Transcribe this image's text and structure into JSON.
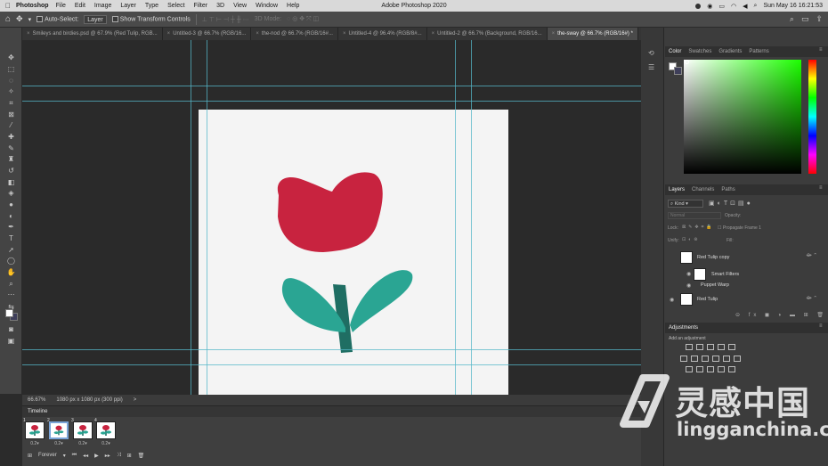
{
  "menubar": {
    "app_name": "Photoshop",
    "items": [
      "File",
      "Edit",
      "Image",
      "Layer",
      "Type",
      "Select",
      "Filter",
      "3D",
      "View",
      "Window",
      "Help"
    ],
    "window_title": "Adobe Photoshop 2020",
    "clock": "Sun May 16  16:21:53"
  },
  "options": {
    "auto_select": "Auto-Select:",
    "auto_select_target": "Layer",
    "show_transform": "Show Transform Controls",
    "mode_3d": "3D Mode:"
  },
  "tabs": [
    {
      "label": "Smileys and birdies.psd @ 67.9% (Red Tulip, RGB..."
    },
    {
      "label": "Untitled-3 @ 66.7% (RGB/16..."
    },
    {
      "label": "the-nod @ 66.7% (RGB/16#..."
    },
    {
      "label": "Untitled-4 @ 96.4% (RGB/8#..."
    },
    {
      "label": "Untitled-2 @ 66.7% (Background, RGB/16..."
    },
    {
      "label": "the-sway @ 66.7% (RGB/16#) *"
    }
  ],
  "status": {
    "zoom": "66.67%",
    "doc_info": "1080 px x 1080 px (300 ppi)"
  },
  "timeline": {
    "title": "Timeline",
    "frames": [
      {
        "num": "1",
        "dur": "0.2▾"
      },
      {
        "num": "2",
        "dur": "0.2▾"
      },
      {
        "num": "3",
        "dur": "0.2▾"
      },
      {
        "num": "4",
        "dur": "0.2▾"
      }
    ],
    "loop": "Forever"
  },
  "color_panel": {
    "tabs": [
      "Color",
      "Swatches",
      "Gradients",
      "Patterns"
    ],
    "foreground": "#ffffff",
    "background": "#3f3f5a"
  },
  "layers_panel": {
    "tabs": [
      "Layers",
      "Channels",
      "Paths"
    ],
    "kind": "Kind",
    "blend_mode": "Normal",
    "opacity_label": "Opacity:",
    "lock_label": "Lock:",
    "fill_label": "Fill:",
    "propagate": "Propagate Frame 1",
    "layers": [
      {
        "name": "Red Tulip copy"
      },
      {
        "name": "Smart Filters"
      },
      {
        "name": "Puppet Warp"
      },
      {
        "name": "Red Tulip"
      }
    ]
  },
  "adjustments": {
    "title": "Adjustments",
    "subtitle": "Add an adjustment"
  },
  "watermark": {
    "cn": "灵感中国",
    "en": "lingganchina.com"
  },
  "colors": {
    "tulip_red": "#c8233f",
    "leaf_teal": "#2aa593",
    "stem": "#1f6e63",
    "guide": "#55b7c8"
  }
}
